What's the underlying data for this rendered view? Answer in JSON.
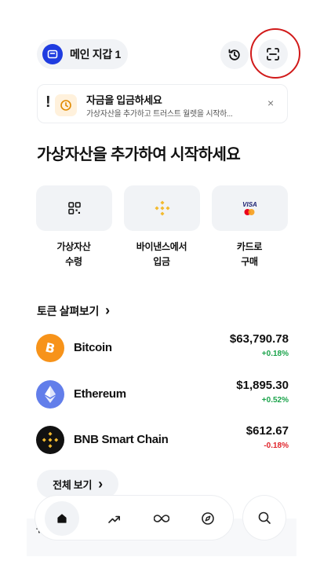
{
  "header": {
    "wallet_label": "메인 지갑 1",
    "wallet_icon": "wallet-icon",
    "history_icon": "history-icon",
    "scan_icon": "scan-icon"
  },
  "notice": {
    "title": "자금을 입금하세요",
    "subtitle": "가상자산을 추가하고 트러스트 월렛을 시작하...",
    "bang": "!",
    "close": "×"
  },
  "headline": "가상자산을 추가하여 시작하세요",
  "actions": [
    {
      "label_line1": "가상자산",
      "label_line2": "수령",
      "icon": "qr-code-icon"
    },
    {
      "label_line1": "바이낸스에서",
      "label_line2": "입금",
      "icon": "binance-icon"
    },
    {
      "label_line1": "카드로",
      "label_line2": "구매",
      "icon": "visa-card-icon",
      "visa_text": "VISA"
    }
  ],
  "tokens_section": {
    "title": "토큰 살펴보기",
    "chevron": "›"
  },
  "tokens": [
    {
      "name": "Bitcoin",
      "price": "$63,790.78",
      "change": "+0.18%",
      "change_color": "#1aa34a",
      "logo_color": "#f7931a"
    },
    {
      "name": "Ethereum",
      "price": "$1,895.30",
      "change": "+0.52%",
      "change_color": "#1aa34a",
      "logo_color": "#627eea"
    },
    {
      "name": "BNB Smart Chain",
      "price": "$612.67",
      "change": "-0.18%",
      "change_color": "#e0242b",
      "logo_color": "#111111"
    }
  ],
  "see_all": {
    "label": "전체 보기",
    "chevron": "›"
  },
  "bottom_nav": {
    "items": [
      "home-icon",
      "trending-icon",
      "infinity-icon",
      "compass-icon"
    ],
    "search_icon": "search-icon",
    "stray_char": "뉴"
  },
  "colors": {
    "accent": "#1f3ce0",
    "highlight_ring": "#d11a1a",
    "surface": "#f1f3f6"
  }
}
